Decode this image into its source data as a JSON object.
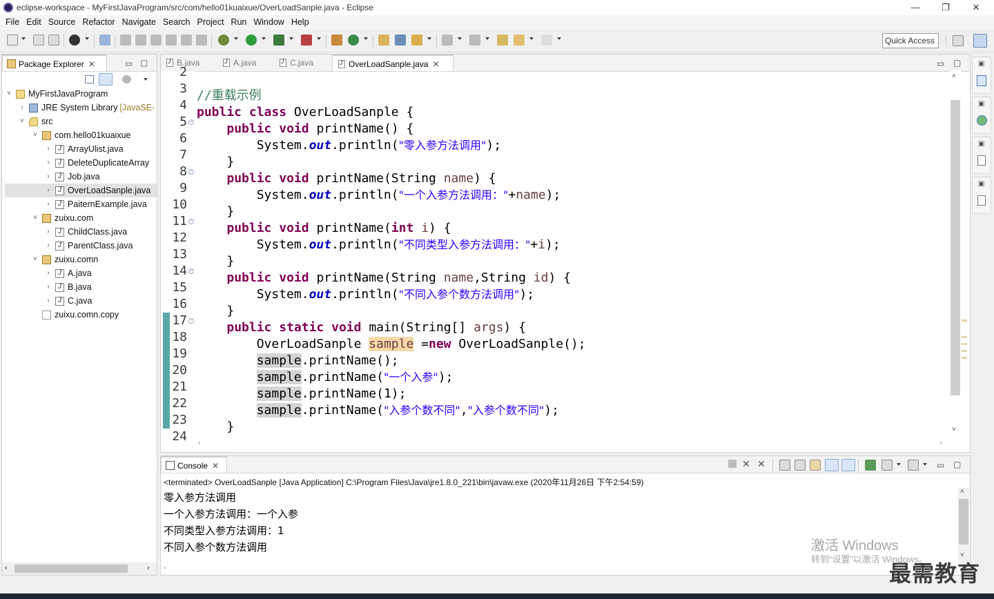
{
  "window": {
    "title": "eclipse-workspace - MyFirstJavaProgram/src/com/hello01kuaixue/OverLoadSanple.java - Eclipse",
    "minimize": "—",
    "restore": "❐",
    "close": "✕"
  },
  "menu": [
    "File",
    "Edit",
    "Source",
    "Refactor",
    "Navigate",
    "Search",
    "Project",
    "Run",
    "Window",
    "Help"
  ],
  "quick_access": "Quick Access",
  "package_explorer": {
    "tab_label": "Package Explorer",
    "tree": [
      {
        "label": "MyFirstJavaProgram",
        "icon": "project-icon",
        "twisty": "˅",
        "indent": 0
      },
      {
        "label": "JRE System Library",
        "decor": "[JavaSE-",
        "icon": "library-icon",
        "twisty": "›",
        "indent": 1
      },
      {
        "label": "src",
        "icon": "source-folder-icon",
        "twisty": "˅",
        "indent": 1
      },
      {
        "label": "com.hello01kuaixue",
        "icon": "package-icon",
        "twisty": "˅",
        "indent": 2
      },
      {
        "label": "ArrayUlist.java",
        "icon": "java-file-icon",
        "twisty": "›",
        "indent": 3
      },
      {
        "label": "DeleteDuplicateArray",
        "icon": "java-file-icon",
        "twisty": "›",
        "indent": 3
      },
      {
        "label": "Job.java",
        "icon": "java-file-icon",
        "twisty": "›",
        "indent": 3
      },
      {
        "label": "OverLoadSanple.java",
        "icon": "java-file-icon",
        "twisty": "›",
        "indent": 3,
        "selected": true
      },
      {
        "label": "PaiternExample.java",
        "icon": "java-file-icon",
        "twisty": "›",
        "indent": 3
      },
      {
        "label": "zuixu.com",
        "icon": "package-icon",
        "twisty": "˅",
        "indent": 2
      },
      {
        "label": "ChildClass.java",
        "icon": "java-file-icon",
        "twisty": "›",
        "indent": 3
      },
      {
        "label": "ParentClass.java",
        "icon": "java-file-icon",
        "twisty": "›",
        "indent": 3
      },
      {
        "label": "zuixu.comn",
        "icon": "package-icon",
        "twisty": "˅",
        "indent": 2
      },
      {
        "label": "A.java",
        "icon": "java-file-icon",
        "twisty": "›",
        "indent": 3
      },
      {
        "label": "B.java",
        "icon": "java-file-icon",
        "twisty": "›",
        "indent": 3
      },
      {
        "label": "C.java",
        "icon": "java-file-icon",
        "twisty": "›",
        "indent": 3
      },
      {
        "label": "zuixu.comn.copy",
        "icon": "empty-package-icon",
        "twisty": "",
        "indent": 2
      }
    ]
  },
  "editor": {
    "tabs": [
      {
        "label": "B.java",
        "active": false
      },
      {
        "label": "A.java",
        "active": false
      },
      {
        "label": "C.java",
        "active": false
      },
      {
        "label": "OverLoadSanple.java",
        "active": true
      }
    ],
    "line_numbers": [
      "2",
      "3",
      "4",
      "5",
      "6",
      "7",
      "8",
      "9",
      "10",
      "11",
      "12",
      "13",
      "14",
      "15",
      "16",
      "17",
      "18",
      "19",
      "20",
      "21",
      "22",
      "23",
      "24"
    ],
    "code": {
      "l3_comment": "//重载示例",
      "kw_public": "public",
      "kw_class": "class",
      "kw_void": "void",
      "kw_static": "static",
      "kw_int": "int",
      "kw_new": "new",
      "class_name": "OverLoadSanple",
      "method": "printName",
      "main": "main",
      "sysout_prefix": "System.",
      "out": "out",
      "println": ".println(",
      "s1": "\"零入参方法调用\"",
      "s2": "\"一个入参方法调用：\"",
      "s3": "\"不同类型入参方法调用：\"",
      "s4": "\"不同入参个数方法调用\"",
      "s5": "\"一个入参\"",
      "s6": "\"入参个数不同\"",
      "s7": "\"入参个数不同\"",
      "var_name": "name",
      "var_i": "i",
      "var_id": "id",
      "var_args": "args",
      "var_sample": "sample",
      "type_string": "String"
    }
  },
  "console": {
    "tab_label": "Console",
    "status": "<terminated> OverLoadSanple [Java Application] C:\\Program Files\\Java\\jre1.8.0_221\\bin\\javaw.exe (2020年11月26日 下午2:54:59)",
    "lines": [
      "零入参方法调用",
      "一个入参方法调用：一个入参",
      "不同类型入参方法调用：1",
      "不同入参个数方法调用"
    ]
  },
  "overlay": {
    "activate_title": "激活 Windows",
    "activate_sub": "转到“设置”以激活 Windows。",
    "watermark": "最需教育"
  }
}
